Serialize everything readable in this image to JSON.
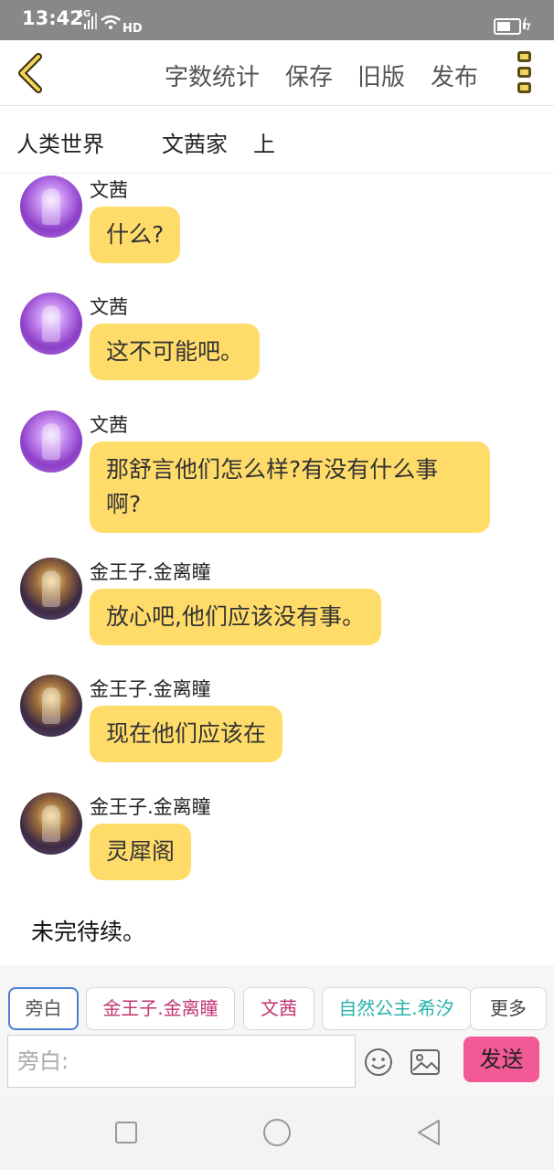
{
  "status_bar": {
    "time": "13:42",
    "network": "4G",
    "wifi_label": "HD"
  },
  "toolbar": {
    "items": [
      "字数统计",
      "保存",
      "旧版",
      "发布"
    ]
  },
  "info": {
    "world": "人类世界",
    "author": "文茜家",
    "position": "上"
  },
  "messages": [
    {
      "name": "文茜",
      "text": "什么?",
      "avatar": "wenxi"
    },
    {
      "name": "文茜",
      "text": "这不可能吧。",
      "avatar": "wenxi"
    },
    {
      "name": "文茜",
      "text_line1": "那舒言他们怎么样?有没有什么事",
      "text_line2": "啊?",
      "avatar": "wenxi"
    },
    {
      "name": "金王子.金离瞳",
      "text": "放心吧,他们应该没有事。",
      "avatar": "jin"
    },
    {
      "name": "金王子.金离瞳",
      "text": "现在他们应该在",
      "avatar": "jin"
    },
    {
      "name": "金王子.金离瞳",
      "text": "灵犀阁",
      "avatar": "jin"
    }
  ],
  "narration": "未完待续。",
  "characters": [
    "旁白",
    "金王子.金离瞳",
    "文茜",
    "自然公主.希汐",
    "更多"
  ],
  "input": {
    "placeholder": "旁白:"
  },
  "send_label": "发送",
  "colors": {
    "bubble": "#ffdc6a",
    "send": "#f25a97",
    "accent": "#f2d45c",
    "active_chip": "#4a7fd6"
  }
}
